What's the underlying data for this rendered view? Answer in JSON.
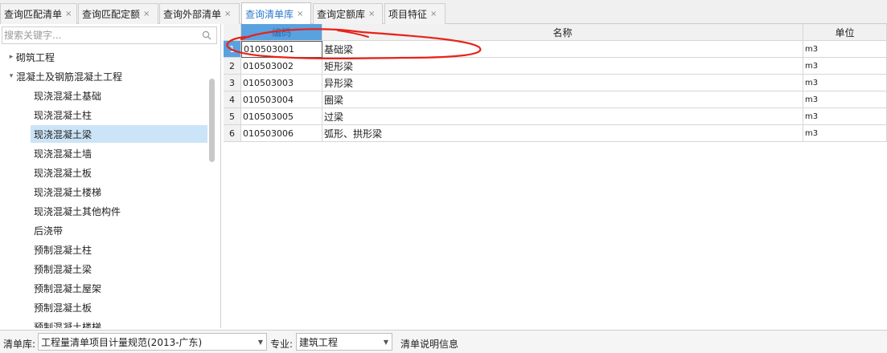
{
  "tabs": [
    {
      "label": "查询匹配清单",
      "close": "×"
    },
    {
      "label": "查询匹配定额",
      "close": "×"
    },
    {
      "label": "查询外部清单",
      "close": "×"
    },
    {
      "label": "查询清单库",
      "close": "×"
    },
    {
      "label": "查询定额库",
      "close": "×"
    },
    {
      "label": "项目特征",
      "close": "×"
    }
  ],
  "search": {
    "placeholder": "搜索关键字..."
  },
  "tree": {
    "parents": [
      {
        "label": "砌筑工程",
        "arrow": "▸"
      },
      {
        "label": "混凝土及钢筋混凝土工程",
        "arrow": "▾"
      }
    ],
    "children": [
      "现浇混凝土基础",
      "现浇混凝土柱",
      "现浇混凝土梁",
      "现浇混凝土墙",
      "现浇混凝土板",
      "现浇混凝土楼梯",
      "现浇混凝土其他构件",
      "后浇带",
      "预制混凝土柱",
      "预制混凝土梁",
      "预制混凝土屋架",
      "预制混凝土板",
      "预制混凝土楼梯"
    ]
  },
  "grid": {
    "headers": {
      "code": "编码",
      "name": "名称",
      "unit": "单位"
    },
    "rows": [
      {
        "num": "1",
        "code": "010503001",
        "name": "基础梁",
        "unit": "m3"
      },
      {
        "num": "2",
        "code": "010503002",
        "name": "矩形梁",
        "unit": "m3"
      },
      {
        "num": "3",
        "code": "010503003",
        "name": "异形梁",
        "unit": "m3"
      },
      {
        "num": "4",
        "code": "010503004",
        "name": "圈梁",
        "unit": "m3"
      },
      {
        "num": "5",
        "code": "010503005",
        "name": "过梁",
        "unit": "m3"
      },
      {
        "num": "6",
        "code": "010503006",
        "name": "弧形、拱形梁",
        "unit": "m3"
      }
    ]
  },
  "bottom": {
    "library_label": "清单库:",
    "library_value": "工程量清单项目计量规范(2013-广东)",
    "specialty_label": "专业:",
    "specialty_value": "建筑工程",
    "info_label": "清单说明信息"
  },
  "colors": {
    "accent": "#2b7ac9",
    "selection": "#cce4f7",
    "header_selected": "#5aa1e0",
    "annotation": "#e8221a"
  },
  "icons": {
    "search": "search-icon",
    "close": "close-icon",
    "dropdown": "chevron-down-icon"
  }
}
